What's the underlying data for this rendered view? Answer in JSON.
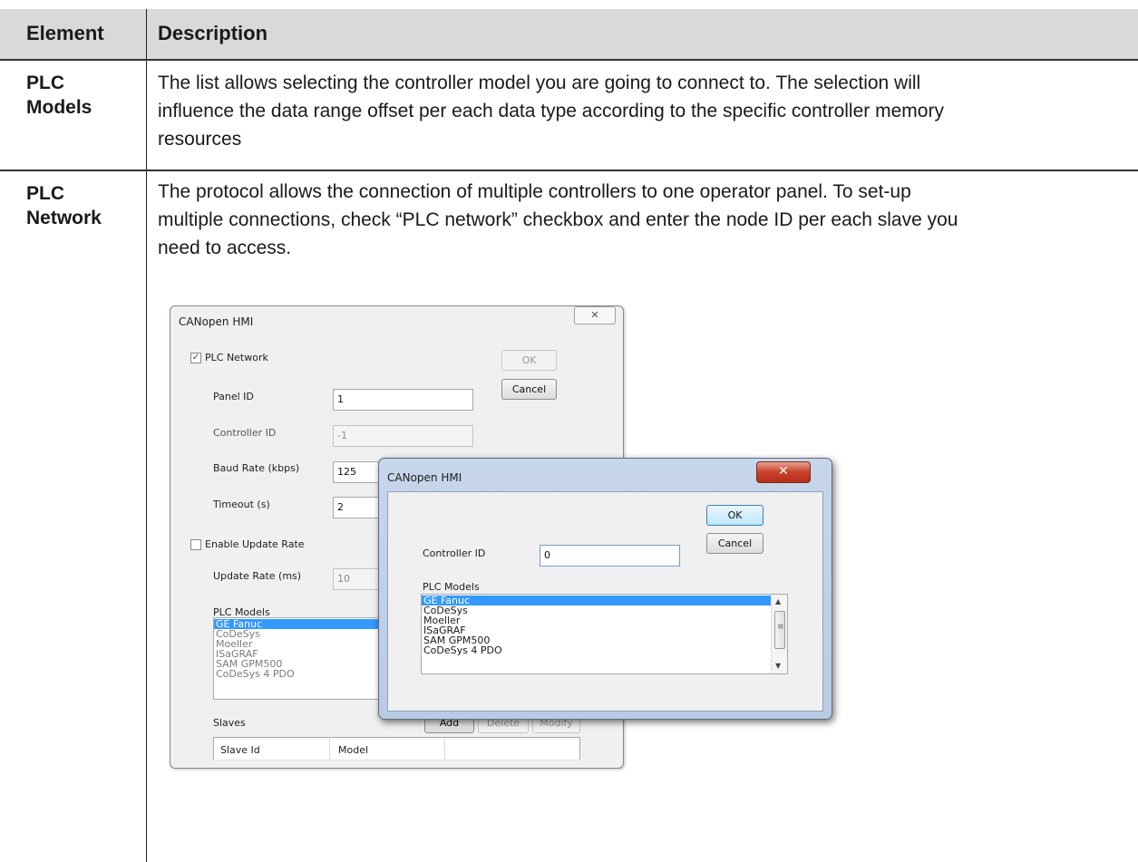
{
  "table": {
    "header": {
      "element": "Element",
      "description": "Description"
    },
    "rows": [
      {
        "element_line1": "PLC",
        "element_line2": "Models",
        "desc_lines": [
          "The list allows selecting the controller model you are going to connect to. The selection will",
          "influence the data range offset per each data type according to the specific controller memory",
          "resources"
        ]
      },
      {
        "element_line1": "PLC",
        "element_line2": "Network",
        "desc_lines": [
          "The protocol allows the connection of multiple controllers to one operator panel. To set-up",
          "multiple connections, check “PLC network” checkbox and enter the node ID per each slave you",
          "need to access."
        ]
      }
    ]
  },
  "dialog_main": {
    "title": "CANopen HMI",
    "close_glyph": "✕",
    "plc_network_label": "PLC Network",
    "plc_network_checked": true,
    "check_glyph": "✓",
    "ok_label": "OK",
    "cancel_label": "Cancel",
    "panel_id_label": "Panel ID",
    "panel_id_value": "1",
    "controller_id_label": "Controller ID",
    "controller_id_value": "-1",
    "baud_rate_label": "Baud Rate (kbps)",
    "baud_rate_value": "125",
    "timeout_label": "Timeout (s)",
    "timeout_value": "2",
    "enable_update_label": "Enable Update Rate",
    "update_rate_label": "Update Rate (ms)",
    "update_rate_value": "10",
    "plc_models_label": "PLC Models",
    "plc_models": [
      "GE Fanuc",
      "CoDeSys",
      "Moeller",
      "ISaGRAF",
      "SAM GPM500",
      "CoDeSys 4 PDO"
    ],
    "slaves_label": "Slaves",
    "add_label": "Add",
    "delete_label": "Delete",
    "modify_label": "Modify",
    "slaves_columns": [
      "Slave Id",
      "Model"
    ]
  },
  "dialog_popup": {
    "title": "CANopen HMI",
    "close_glyph": "✕",
    "ok_label": "OK",
    "cancel_label": "Cancel",
    "controller_id_label": "Controller ID",
    "controller_id_value": "0",
    "plc_models_label": "PLC Models",
    "plc_models": [
      "GE Fanuc",
      "CoDeSys",
      "Moeller",
      "ISaGRAF",
      "SAM GPM500",
      "CoDeSys 4 PDO"
    ],
    "scroll_up_glyph": "▲",
    "scroll_down_glyph": "▼",
    "scroll_grip_glyph": "≡"
  }
}
